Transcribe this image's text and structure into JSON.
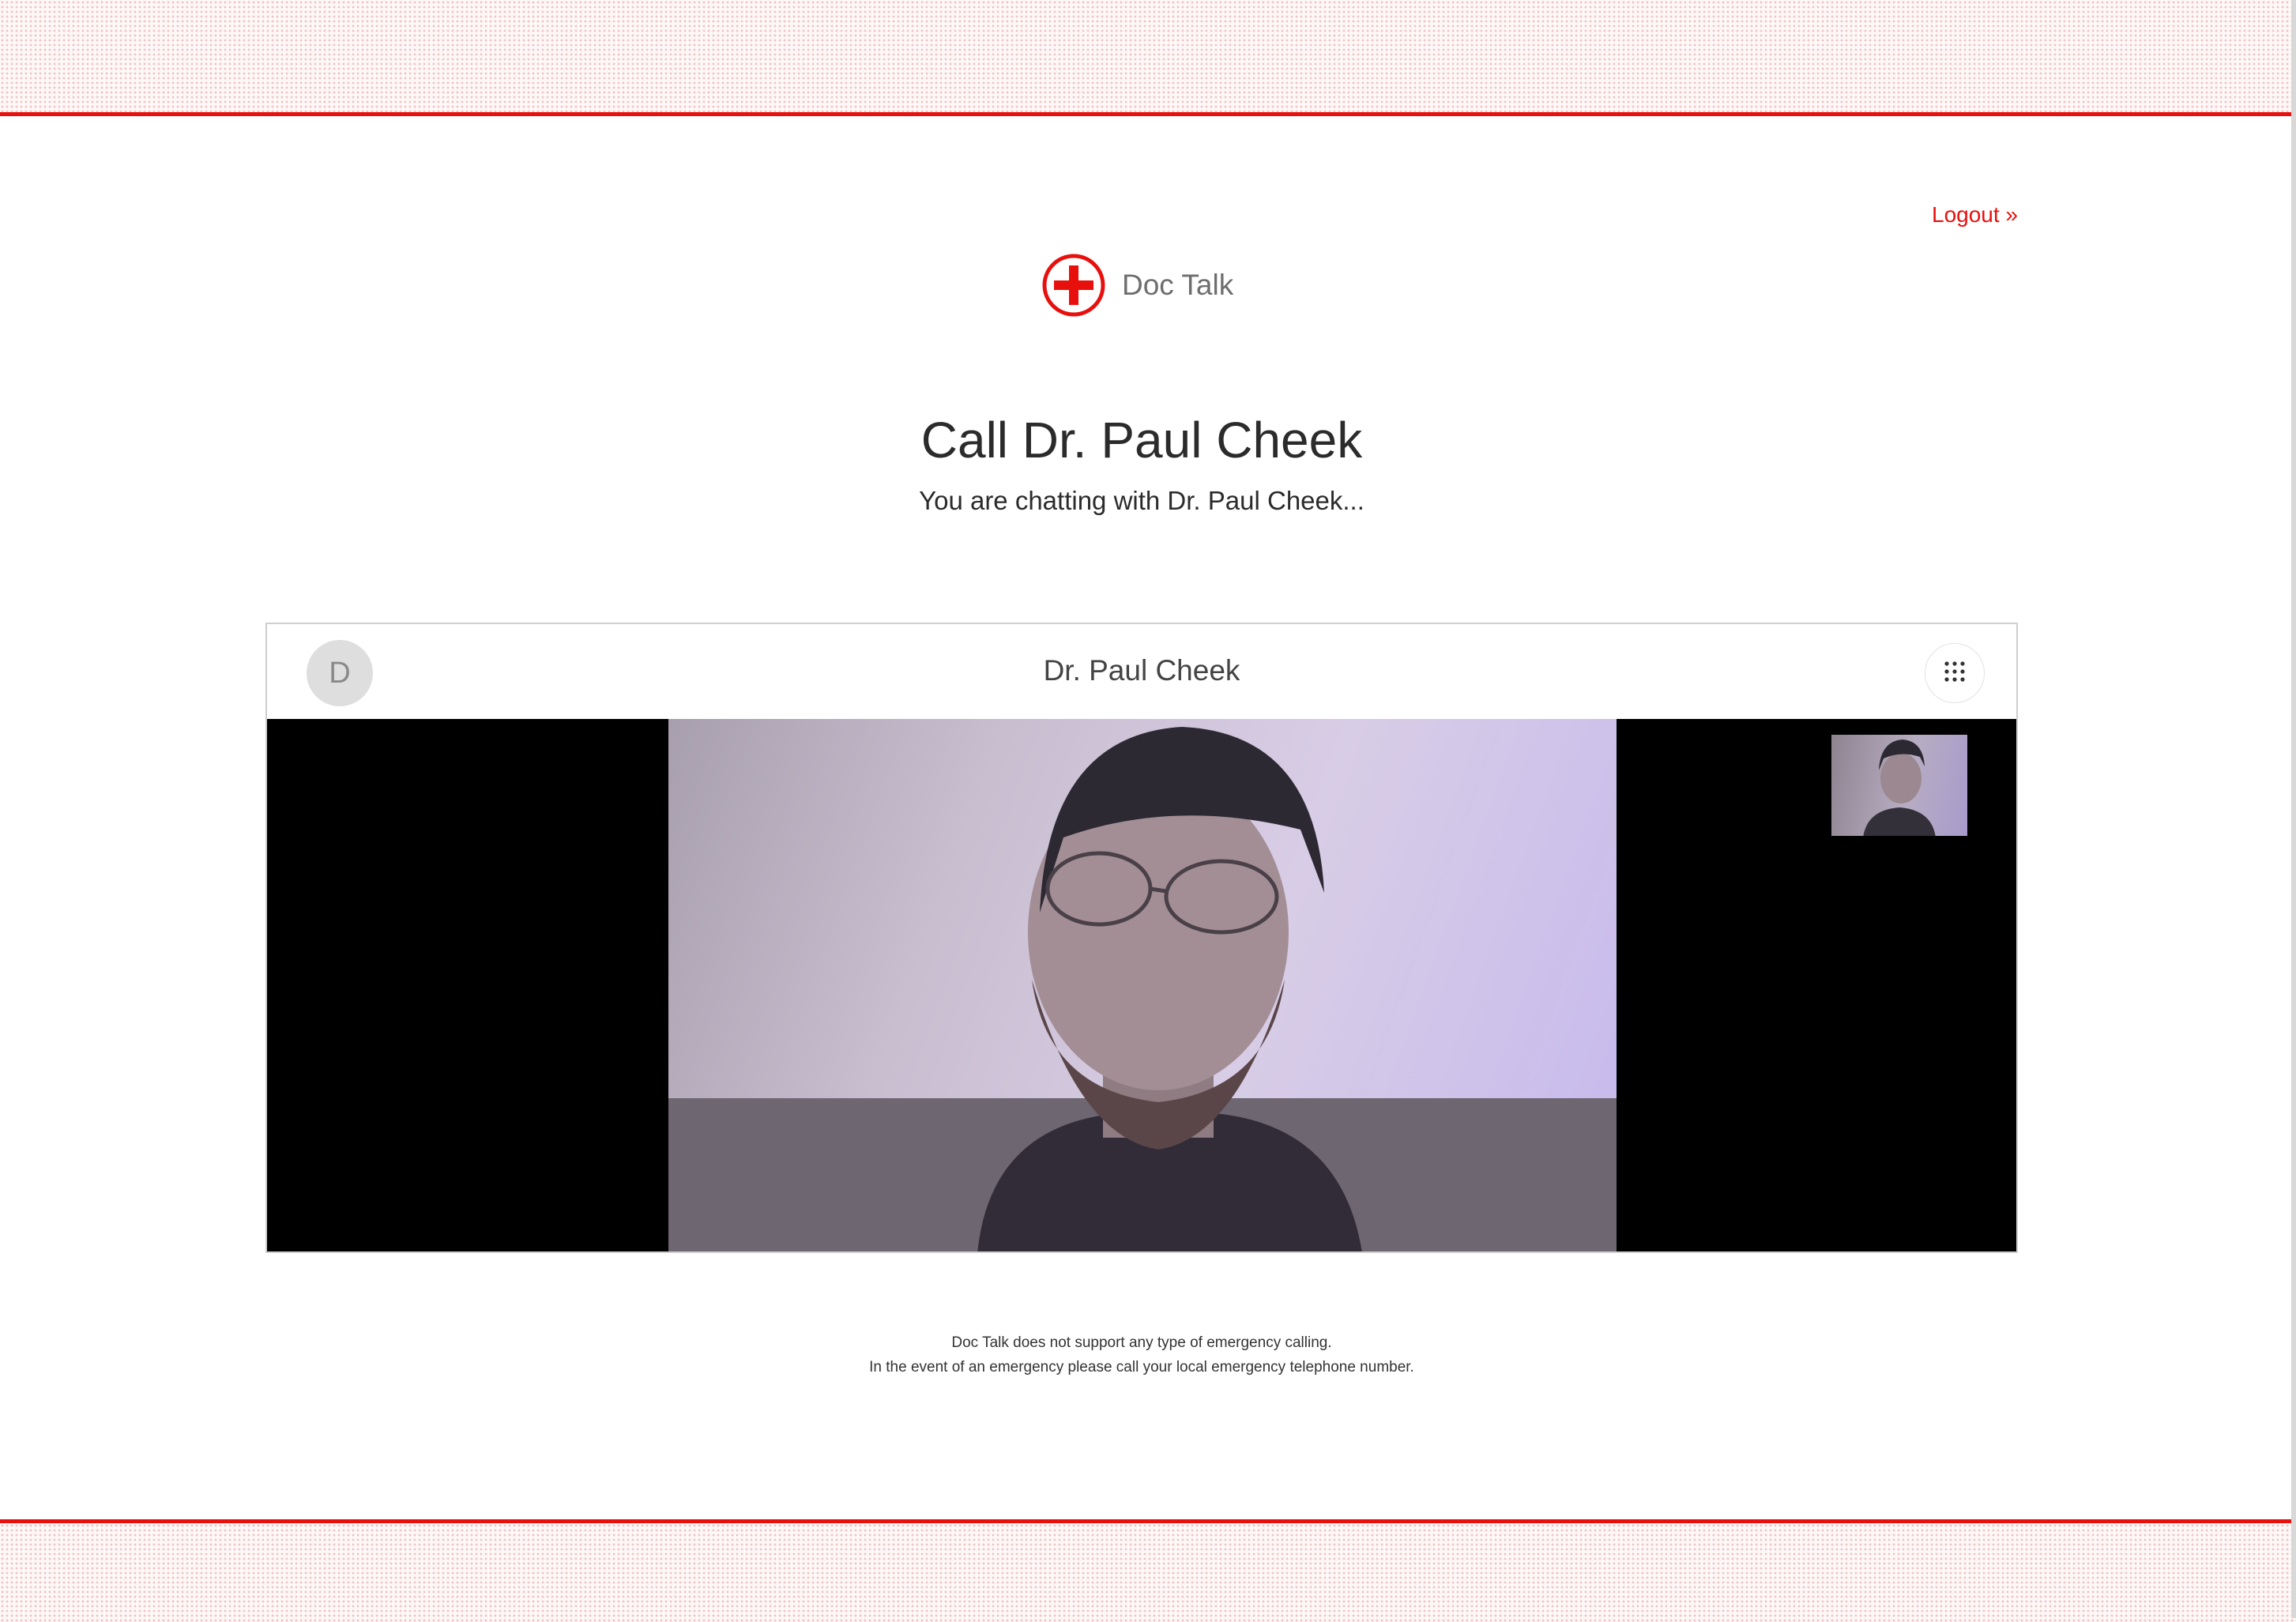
{
  "header": {
    "logout_label": "Logout »",
    "brand_name": "Doc Talk"
  },
  "main": {
    "title": "Call Dr. Paul Cheek",
    "subtitle": "You are chatting with Dr. Paul Cheek..."
  },
  "call": {
    "avatar_initial": "D",
    "contact_name": "Dr. Paul Cheek"
  },
  "footer": {
    "disclaimer_line1": "Doc Talk does not support any type of emergency calling.",
    "disclaimer_line2": "In the event of an emergency please call your local emergency telephone number."
  },
  "colors": {
    "accent": "#e8100d",
    "text": "#2b2b2b",
    "video_background": "#000000"
  },
  "icons": {
    "logo": "red-cross-icon",
    "keypad": "keypad-grid-icon"
  }
}
